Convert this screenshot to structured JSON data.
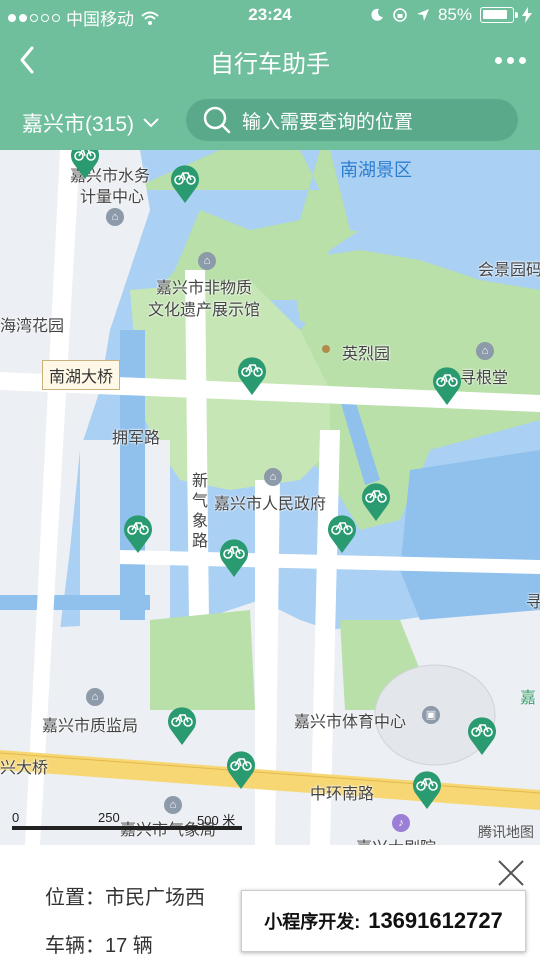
{
  "status_bar": {
    "carrier": "中国移动",
    "time": "23:24",
    "battery": "85%",
    "battery_level": 0.85
  },
  "nav": {
    "title": "自行车助手"
  },
  "filter": {
    "city": "嘉兴市(315)",
    "search_placeholder": "输入需要查询的位置"
  },
  "map": {
    "labels": {
      "water_bureau": "嘉兴市水务",
      "metering": "计量中心",
      "nanhu_scenic": "南湖景区",
      "heritage_1": "嘉兴市非物质",
      "heritage_2": "文化遗产展示馆",
      "huiyuan": "会景园码",
      "haiwan": "海湾花园",
      "bridge": "南湖大桥",
      "lieshi": "英烈园",
      "xungen": "寻根堂",
      "yongjun": "拥军路",
      "qixiang": "新气象路",
      "gov": "嘉兴市人民政府",
      "zhijian": "嘉兴市质监局",
      "sports": "嘉兴市体育中心",
      "jiaxing_edge": "嘉",
      "daqiao": "兴大桥",
      "zhonghuan": "中环南路",
      "weather": "嘉兴市气象局",
      "theater": "嘉兴大剧院",
      "right_edge": "寻"
    },
    "scale": {
      "s0": "0",
      "s1": "250",
      "s2": "500 米"
    },
    "brand": "腾讯地图"
  },
  "station": {
    "location": "位置：市民广场西",
    "bikes": "车辆：17 辆"
  },
  "promo": {
    "label": "小程序开发:",
    "phone": "13691612727"
  }
}
